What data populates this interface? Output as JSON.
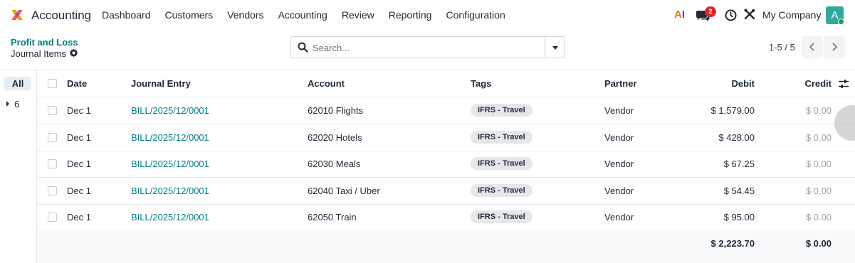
{
  "navbar": {
    "app_name": "Accounting",
    "menu": [
      "Dashboard",
      "Customers",
      "Vendors",
      "Accounting",
      "Review",
      "Reporting",
      "Configuration"
    ],
    "ai_label_a": "A",
    "ai_label_i": "I",
    "chat_badge": "2",
    "company": "My Company",
    "avatar_letter": "A"
  },
  "control": {
    "breadcrumb": "Profit and Loss",
    "title": "Journal Items",
    "search_placeholder": "Search...",
    "pager": "1-5 / 5"
  },
  "side_panel": {
    "all_label": "All",
    "group_label": "6"
  },
  "table": {
    "headers": {
      "date": "Date",
      "entry": "Journal Entry",
      "account": "Account",
      "tags": "Tags",
      "partner": "Partner",
      "debit": "Debit",
      "credit": "Credit"
    },
    "rows": [
      {
        "date": "Dec 1",
        "entry": "BILL/2025/12/0001",
        "account": "62010 Flights",
        "tag": "IFRS - Travel",
        "partner": "Vendor",
        "debit": "$ 1,579.00",
        "credit": "$ 0.00"
      },
      {
        "date": "Dec 1",
        "entry": "BILL/2025/12/0001",
        "account": "62020 Hotels",
        "tag": "IFRS - Travel",
        "partner": "Vendor",
        "debit": "$ 428.00",
        "credit": "$ 0.00"
      },
      {
        "date": "Dec 1",
        "entry": "BILL/2025/12/0001",
        "account": "62030 Meals",
        "tag": "IFRS - Travel",
        "partner": "Vendor",
        "debit": "$ 67.25",
        "credit": "$ 0.00"
      },
      {
        "date": "Dec 1",
        "entry": "BILL/2025/12/0001",
        "account": "62040 Taxi / Uber",
        "tag": "IFRS - Travel",
        "partner": "Vendor",
        "debit": "$ 54.45",
        "credit": "$ 0.00"
      },
      {
        "date": "Dec 1",
        "entry": "BILL/2025/12/0001",
        "account": "62050 Train",
        "tag": "IFRS - Travel",
        "partner": "Vendor",
        "debit": "$ 95.00",
        "credit": "$ 0.00"
      }
    ],
    "totals": {
      "debit": "$ 2,223.70",
      "credit": "$ 0.00"
    }
  }
}
